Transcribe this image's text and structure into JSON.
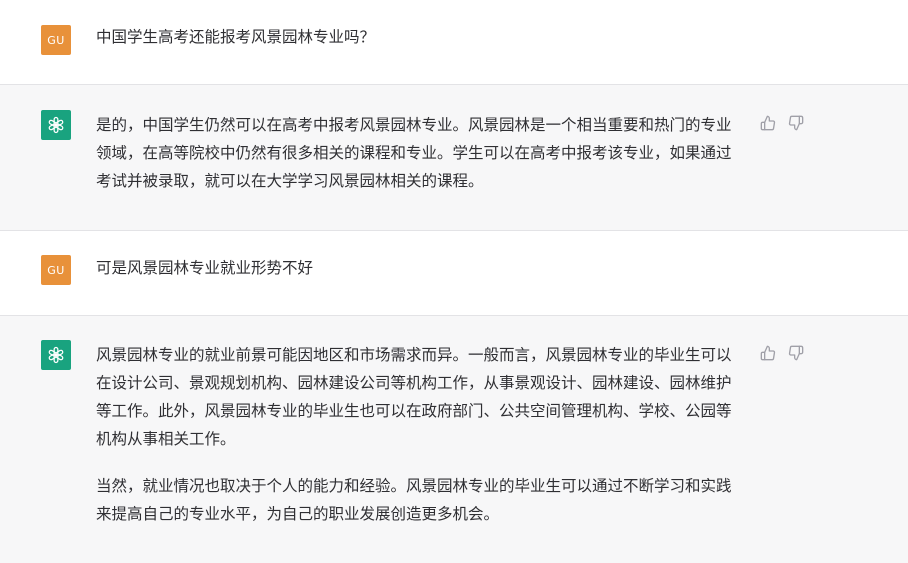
{
  "conversation": [
    {
      "role": "user",
      "avatar_text": "GU",
      "text": "中国学生高考还能报考风景园林专业吗？"
    },
    {
      "role": "assistant",
      "avatar_icon": "openai-logo-icon",
      "paragraphs": [
        "是的，中国学生仍然可以在高考中报考风景园林专业。风景园林是一个相当重要和热门的专业领域，在高等院校中仍然有很多相关的课程和专业。学生可以在高考中报考该专业，如果通过考试并被录取，就可以在大学学习风景园林相关的课程。"
      ]
    },
    {
      "role": "user",
      "avatar_text": "GU",
      "text": "可是风景园林专业就业形势不好"
    },
    {
      "role": "assistant",
      "avatar_icon": "openai-logo-icon",
      "paragraphs": [
        "风景园林专业的就业前景可能因地区和市场需求而异。一般而言，风景园林专业的毕业生可以在设计公司、景观规划机构、园林建设公司等机构工作，从事景观设计、园林建设、园林维护等工作。此外，风景园林专业的毕业生也可以在政府部门、公共空间管理机构、学校、公园等机构从事相关工作。",
        "当然，就业情况也取决于个人的能力和经验。风景园林专业的毕业生可以通过不断学习和实践来提高自己的专业水平，为自己的职业发展创造更多机会。"
      ]
    }
  ],
  "icons": {
    "thumbs_up": "thumbs-up-icon",
    "thumbs_down": "thumbs-down-icon"
  },
  "colors": {
    "user_avatar": "#e8913a",
    "assistant_avatar": "#19a37f",
    "assistant_row_bg": "#f7f7f8",
    "text": "#2f2f33",
    "icon": "#a0a0a8"
  }
}
